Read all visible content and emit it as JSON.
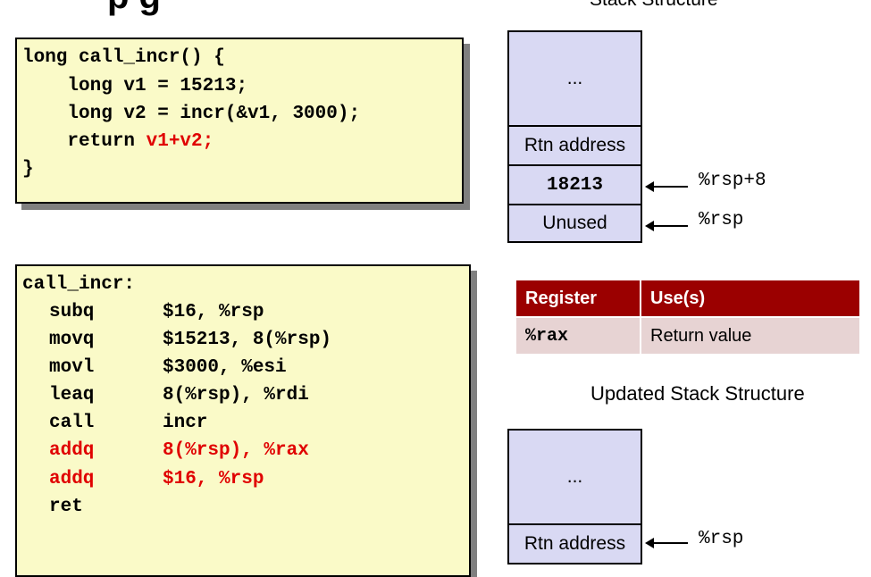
{
  "title_fragment": "p      g",
  "stack_top_title": "Stack Structure",
  "c_code": {
    "lines": [
      {
        "text": "long call_incr() {",
        "red": ""
      },
      {
        "text": "    long v1 = 15213;",
        "red": ""
      },
      {
        "text": "    long v2 = incr(&v1, 3000);",
        "red": ""
      },
      {
        "text": "    return ",
        "red": "v1+v2;"
      },
      {
        "text": "}",
        "red": ""
      }
    ]
  },
  "asm_code": {
    "label": "call_incr:",
    "lines": [
      {
        "op": "subq",
        "args": "$16, %rsp",
        "highlight": false
      },
      {
        "op": "movq",
        "args": "$15213, 8(%rsp)",
        "highlight": false
      },
      {
        "op": "movl",
        "args": "$3000, %esi",
        "highlight": false
      },
      {
        "op": "leaq",
        "args": "8(%rsp), %rdi",
        "highlight": false
      },
      {
        "op": "call",
        "args": "incr",
        "highlight": false
      },
      {
        "op": "addq",
        "args": "8(%rsp), %rax",
        "highlight": true
      },
      {
        "op": "addq",
        "args": "$16, %rsp",
        "highlight": true
      },
      {
        "op": "ret",
        "args": "",
        "highlight": false
      }
    ]
  },
  "stack_before": {
    "cells": [
      "...",
      "Rtn address",
      "18213",
      "Unused"
    ],
    "pointers": {
      "rsp_plus_8": "%rsp+8",
      "rsp": "%rsp"
    }
  },
  "register_table": {
    "headers": [
      "Register",
      "Use(s)"
    ],
    "rows": [
      [
        "%rax",
        "Return value"
      ]
    ]
  },
  "updated_title": "Updated Stack Structure",
  "stack_after": {
    "cells": [
      "...",
      "Rtn address"
    ],
    "pointer": "%rsp"
  },
  "colors": {
    "highlight_red": "#e00000",
    "code_bg": "#fafac8",
    "stack_bg": "#d9d9f3",
    "table_header": "#9b0000",
    "table_row": "#e7d3d3"
  }
}
